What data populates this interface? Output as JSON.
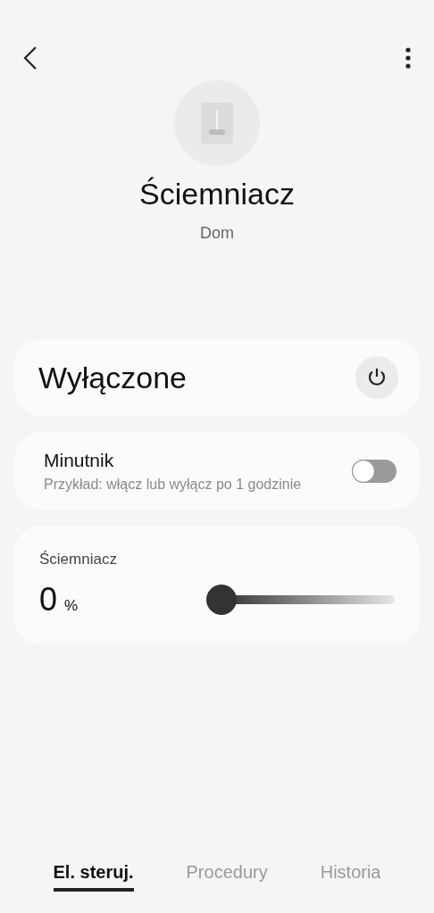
{
  "device": {
    "name": "Ściemniacz",
    "location": "Dom"
  },
  "power": {
    "status": "Wyłączone",
    "on": false
  },
  "timer": {
    "title": "Minutnik",
    "description": "Przykład: włącz lub wyłącz po 1 godzinie",
    "on": false
  },
  "dimmer": {
    "label": "Ściemniacz",
    "value": "0",
    "unit": "%",
    "level": 0
  },
  "tabs": [
    {
      "label": "El. steruj.",
      "selected": true
    },
    {
      "label": "Procedury",
      "selected": false
    },
    {
      "label": "Historia",
      "selected": false
    }
  ]
}
